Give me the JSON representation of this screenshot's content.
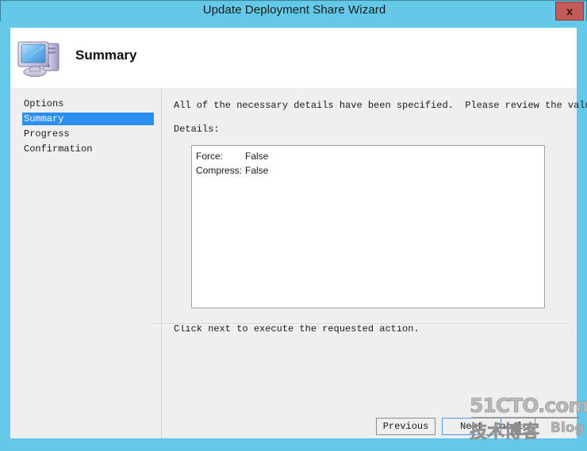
{
  "window": {
    "title": "Update Deployment Share Wizard",
    "close_label": "x"
  },
  "header": {
    "page_title": "Summary",
    "icon": "computer-monitor-icon"
  },
  "sidebar": {
    "items": [
      {
        "label": "Options",
        "selected": false
      },
      {
        "label": "Summary",
        "selected": true
      },
      {
        "label": "Progress",
        "selected": false
      },
      {
        "label": "Confirmation",
        "selected": false
      }
    ]
  },
  "content": {
    "intro_text": "All of the necessary details have been specified.  Please review the values below.",
    "details_label": "Details:",
    "details": [
      {
        "key": "Force:",
        "value": "False"
      },
      {
        "key": "Compress:",
        "value": "False"
      }
    ],
    "footer_note": "Click next to execute the requested action."
  },
  "buttons": {
    "previous": "Previous",
    "next": "Next",
    "cancel": "Cancel"
  },
  "watermark": {
    "line1": "51CTO.com",
    "line2": "技术博客",
    "line2b": "Blog"
  },
  "colors": {
    "titlebar": "#64c8e8",
    "close_button": "#c25b58",
    "selection": "#2b8ff0",
    "body": "#efefef",
    "header": "#ffffff"
  }
}
